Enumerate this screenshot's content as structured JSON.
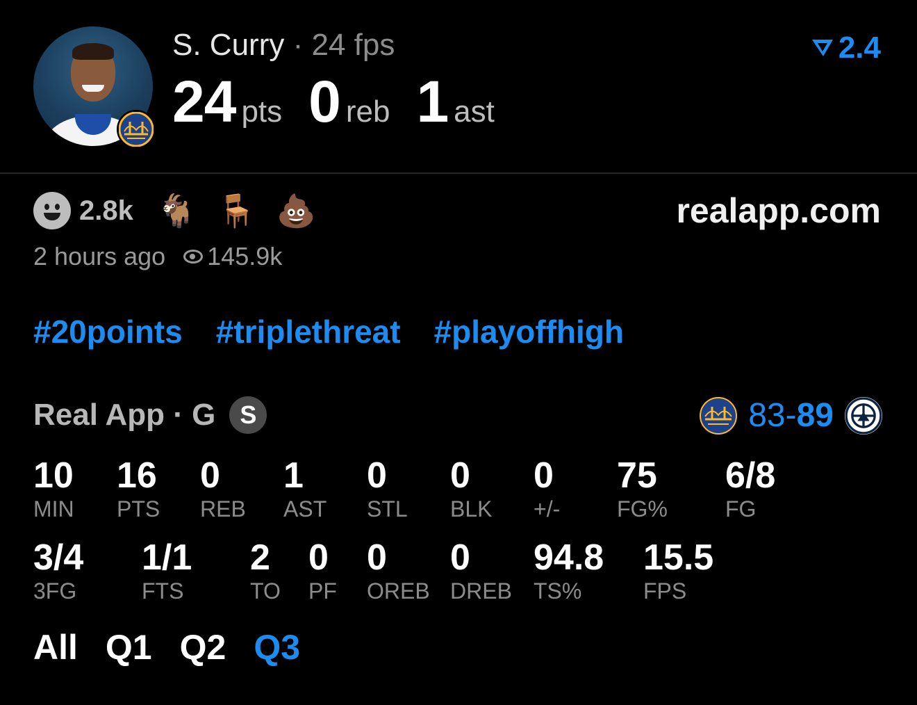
{
  "player": {
    "name": "S. Curry",
    "separator": " · ",
    "fps_label": "24 fps",
    "points": "24",
    "points_label": "pts",
    "rebounds": "0",
    "rebounds_label": "reb",
    "assists": "1",
    "assists_label": "ast"
  },
  "version": {
    "value": "2.4",
    "icon": "real-v-logo-icon"
  },
  "reactions": {
    "count": "2.8k",
    "emojis": [
      "🐐",
      "🪑",
      "💩"
    ]
  },
  "site": "realapp.com",
  "meta": {
    "time_ago": "2 hours ago",
    "views": "145.9k"
  },
  "tags": [
    "#20points",
    "#triplethreat",
    "#playoffhigh"
  ],
  "game": {
    "label": "Real App · G",
    "badge": "S",
    "score_left": "83",
    "score_dash": "-",
    "score_right": "89"
  },
  "stats_row1": [
    {
      "value": "10",
      "label": "MIN"
    },
    {
      "value": "16",
      "label": "PTS"
    },
    {
      "value": "0",
      "label": "REB"
    },
    {
      "value": "1",
      "label": "AST"
    },
    {
      "value": "0",
      "label": "STL"
    },
    {
      "value": "0",
      "label": "BLK"
    },
    {
      "value": "0",
      "label": "+/-"
    },
    {
      "value": "75",
      "label": "FG%"
    },
    {
      "value": "6/8",
      "label": "FG"
    }
  ],
  "stats_row2": [
    {
      "value": "3/4",
      "label": "3FG"
    },
    {
      "value": "1/1",
      "label": "FTS"
    },
    {
      "value": "2",
      "label": "TO"
    },
    {
      "value": "0",
      "label": "PF"
    },
    {
      "value": "0",
      "label": "OREB"
    },
    {
      "value": "0",
      "label": "DREB"
    },
    {
      "value": "94.8",
      "label": "TS%"
    },
    {
      "value": "15.5",
      "label": "FPS"
    }
  ],
  "quarters": [
    "All",
    "Q1",
    "Q2",
    "Q3"
  ],
  "active_quarter": "Q3",
  "colors": {
    "accent": "#1d8cf0",
    "background": "#000000"
  }
}
